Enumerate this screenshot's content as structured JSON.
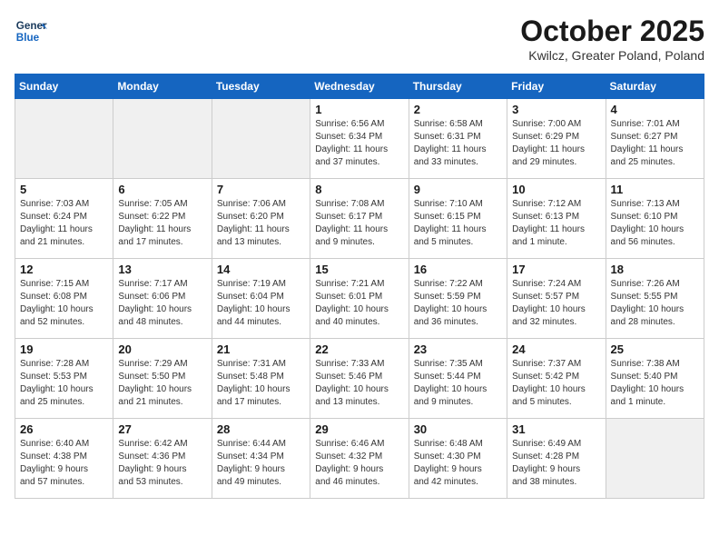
{
  "header": {
    "logo_line1": "General",
    "logo_line2": "Blue",
    "month": "October 2025",
    "location": "Kwilcz, Greater Poland, Poland"
  },
  "weekdays": [
    "Sunday",
    "Monday",
    "Tuesday",
    "Wednesday",
    "Thursday",
    "Friday",
    "Saturday"
  ],
  "weeks": [
    [
      {
        "day": "",
        "info": ""
      },
      {
        "day": "",
        "info": ""
      },
      {
        "day": "",
        "info": ""
      },
      {
        "day": "1",
        "info": "Sunrise: 6:56 AM\nSunset: 6:34 PM\nDaylight: 11 hours\nand 37 minutes."
      },
      {
        "day": "2",
        "info": "Sunrise: 6:58 AM\nSunset: 6:31 PM\nDaylight: 11 hours\nand 33 minutes."
      },
      {
        "day": "3",
        "info": "Sunrise: 7:00 AM\nSunset: 6:29 PM\nDaylight: 11 hours\nand 29 minutes."
      },
      {
        "day": "4",
        "info": "Sunrise: 7:01 AM\nSunset: 6:27 PM\nDaylight: 11 hours\nand 25 minutes."
      }
    ],
    [
      {
        "day": "5",
        "info": "Sunrise: 7:03 AM\nSunset: 6:24 PM\nDaylight: 11 hours\nand 21 minutes."
      },
      {
        "day": "6",
        "info": "Sunrise: 7:05 AM\nSunset: 6:22 PM\nDaylight: 11 hours\nand 17 minutes."
      },
      {
        "day": "7",
        "info": "Sunrise: 7:06 AM\nSunset: 6:20 PM\nDaylight: 11 hours\nand 13 minutes."
      },
      {
        "day": "8",
        "info": "Sunrise: 7:08 AM\nSunset: 6:17 PM\nDaylight: 11 hours\nand 9 minutes."
      },
      {
        "day": "9",
        "info": "Sunrise: 7:10 AM\nSunset: 6:15 PM\nDaylight: 11 hours\nand 5 minutes."
      },
      {
        "day": "10",
        "info": "Sunrise: 7:12 AM\nSunset: 6:13 PM\nDaylight: 11 hours\nand 1 minute."
      },
      {
        "day": "11",
        "info": "Sunrise: 7:13 AM\nSunset: 6:10 PM\nDaylight: 10 hours\nand 56 minutes."
      }
    ],
    [
      {
        "day": "12",
        "info": "Sunrise: 7:15 AM\nSunset: 6:08 PM\nDaylight: 10 hours\nand 52 minutes."
      },
      {
        "day": "13",
        "info": "Sunrise: 7:17 AM\nSunset: 6:06 PM\nDaylight: 10 hours\nand 48 minutes."
      },
      {
        "day": "14",
        "info": "Sunrise: 7:19 AM\nSunset: 6:04 PM\nDaylight: 10 hours\nand 44 minutes."
      },
      {
        "day": "15",
        "info": "Sunrise: 7:21 AM\nSunset: 6:01 PM\nDaylight: 10 hours\nand 40 minutes."
      },
      {
        "day": "16",
        "info": "Sunrise: 7:22 AM\nSunset: 5:59 PM\nDaylight: 10 hours\nand 36 minutes."
      },
      {
        "day": "17",
        "info": "Sunrise: 7:24 AM\nSunset: 5:57 PM\nDaylight: 10 hours\nand 32 minutes."
      },
      {
        "day": "18",
        "info": "Sunrise: 7:26 AM\nSunset: 5:55 PM\nDaylight: 10 hours\nand 28 minutes."
      }
    ],
    [
      {
        "day": "19",
        "info": "Sunrise: 7:28 AM\nSunset: 5:53 PM\nDaylight: 10 hours\nand 25 minutes."
      },
      {
        "day": "20",
        "info": "Sunrise: 7:29 AM\nSunset: 5:50 PM\nDaylight: 10 hours\nand 21 minutes."
      },
      {
        "day": "21",
        "info": "Sunrise: 7:31 AM\nSunset: 5:48 PM\nDaylight: 10 hours\nand 17 minutes."
      },
      {
        "day": "22",
        "info": "Sunrise: 7:33 AM\nSunset: 5:46 PM\nDaylight: 10 hours\nand 13 minutes."
      },
      {
        "day": "23",
        "info": "Sunrise: 7:35 AM\nSunset: 5:44 PM\nDaylight: 10 hours\nand 9 minutes."
      },
      {
        "day": "24",
        "info": "Sunrise: 7:37 AM\nSunset: 5:42 PM\nDaylight: 10 hours\nand 5 minutes."
      },
      {
        "day": "25",
        "info": "Sunrise: 7:38 AM\nSunset: 5:40 PM\nDaylight: 10 hours\nand 1 minute."
      }
    ],
    [
      {
        "day": "26",
        "info": "Sunrise: 6:40 AM\nSunset: 4:38 PM\nDaylight: 9 hours\nand 57 minutes."
      },
      {
        "day": "27",
        "info": "Sunrise: 6:42 AM\nSunset: 4:36 PM\nDaylight: 9 hours\nand 53 minutes."
      },
      {
        "day": "28",
        "info": "Sunrise: 6:44 AM\nSunset: 4:34 PM\nDaylight: 9 hours\nand 49 minutes."
      },
      {
        "day": "29",
        "info": "Sunrise: 6:46 AM\nSunset: 4:32 PM\nDaylight: 9 hours\nand 46 minutes."
      },
      {
        "day": "30",
        "info": "Sunrise: 6:48 AM\nSunset: 4:30 PM\nDaylight: 9 hours\nand 42 minutes."
      },
      {
        "day": "31",
        "info": "Sunrise: 6:49 AM\nSunset: 4:28 PM\nDaylight: 9 hours\nand 38 minutes."
      },
      {
        "day": "",
        "info": ""
      }
    ]
  ]
}
